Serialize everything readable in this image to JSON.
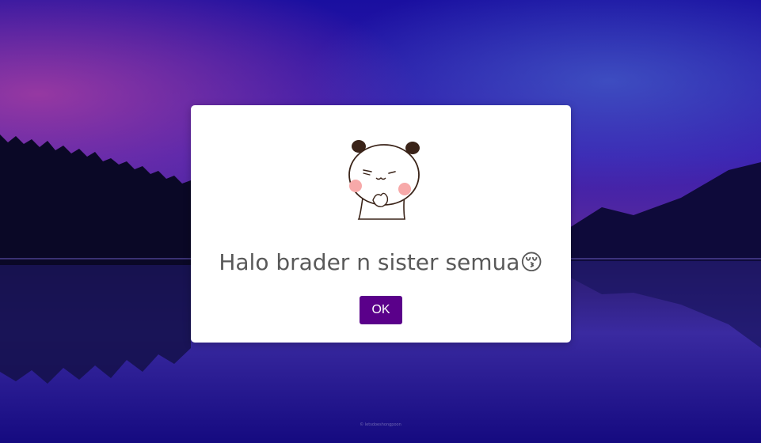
{
  "dialog": {
    "message": "Halo brader n sister semua",
    "emoji": "😚",
    "ok_label": "OK",
    "image_icon": "panda-cartoon-icon",
    "button_color": "#5a008a"
  },
  "background": {
    "description_icon": "lake-forest-night-background",
    "credit": "© letsdoeshongpoon"
  }
}
